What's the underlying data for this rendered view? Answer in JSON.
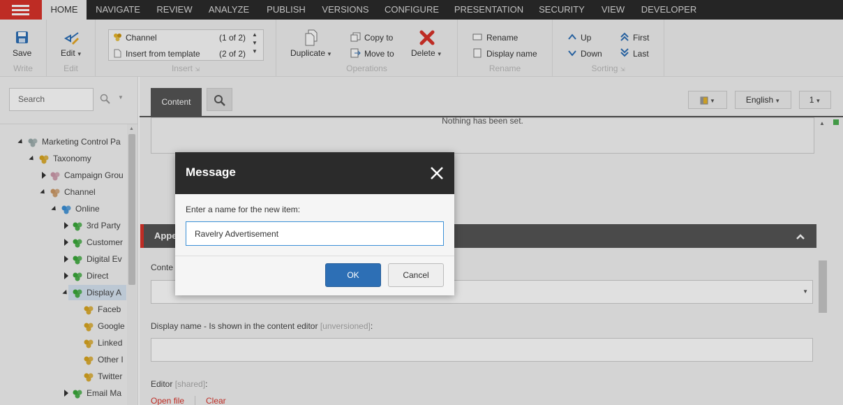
{
  "menu": {
    "tabs": [
      "HOME",
      "NAVIGATE",
      "REVIEW",
      "ANALYZE",
      "PUBLISH",
      "VERSIONS",
      "CONFIGURE",
      "PRESENTATION",
      "SECURITY",
      "VIEW",
      "DEVELOPER"
    ],
    "active": "HOME"
  },
  "ribbon": {
    "write": {
      "save": "Save",
      "label": "Write"
    },
    "edit": {
      "edit": "Edit",
      "label": "Edit"
    },
    "insert": {
      "items": [
        {
          "label": "Channel",
          "count": "(1 of 2)"
        },
        {
          "label": "Insert from template",
          "count": "(2 of 2)"
        }
      ],
      "label": "Insert"
    },
    "operations": {
      "duplicate": "Duplicate",
      "copy_to": "Copy to",
      "move_to": "Move to",
      "delete": "Delete",
      "label": "Operations"
    },
    "rename": {
      "rename": "Rename",
      "display_name": "Display name",
      "label": "Rename"
    },
    "sorting": {
      "up": "Up",
      "down": "Down",
      "first": "First",
      "last": "Last",
      "label": "Sorting"
    }
  },
  "search": {
    "placeholder": "Search"
  },
  "tree": [
    {
      "label": "Marketing Control Pa",
      "depth": 0,
      "state": "open",
      "icon": "control-panel-icon"
    },
    {
      "label": "Taxonomy",
      "depth": 1,
      "state": "open",
      "icon": "taxonomy-icon"
    },
    {
      "label": "Campaign Grou",
      "depth": 2,
      "state": "closed",
      "icon": "list-icon"
    },
    {
      "label": "Channel",
      "depth": 2,
      "state": "open",
      "icon": "channel-icon"
    },
    {
      "label": "Online",
      "depth": 3,
      "state": "open",
      "icon": "online-icon"
    },
    {
      "label": "3rd Party",
      "depth": 4,
      "state": "closed",
      "icon": "group-green-icon"
    },
    {
      "label": "Customer",
      "depth": 4,
      "state": "closed",
      "icon": "group-green-icon"
    },
    {
      "label": "Digital Ev",
      "depth": 4,
      "state": "closed",
      "icon": "group-green-icon"
    },
    {
      "label": "Direct",
      "depth": 4,
      "state": "closed",
      "icon": "group-green-icon"
    },
    {
      "label": "Display A",
      "depth": 4,
      "state": "open",
      "icon": "group-green-icon",
      "selected": true
    },
    {
      "label": "Faceb",
      "depth": 5,
      "state": "leaf",
      "icon": "group-yellow-icon"
    },
    {
      "label": "Google",
      "depth": 5,
      "state": "leaf",
      "icon": "group-yellow-icon"
    },
    {
      "label": "Linked",
      "depth": 5,
      "state": "leaf",
      "icon": "group-yellow-icon"
    },
    {
      "label": "Other I",
      "depth": 5,
      "state": "leaf",
      "icon": "group-yellow-icon"
    },
    {
      "label": "Twitter",
      "depth": 5,
      "state": "leaf",
      "icon": "group-yellow-icon"
    },
    {
      "label": "Email Ma",
      "depth": 4,
      "state": "closed",
      "icon": "group-green-icon"
    }
  ],
  "editor": {
    "content_tab": "Content",
    "language": "English",
    "version": "1",
    "nothing_set": "Nothing has been set.",
    "section_title": "Appea",
    "content_label": "Conte",
    "display_name_label": "Display name - Is shown in the content editor",
    "display_name_tag": "[unversioned]",
    "display_name_suffix": ":",
    "editor_label": "Editor",
    "editor_tag": "[shared]",
    "editor_suffix": ":",
    "open_file": "Open file",
    "clear": "Clear"
  },
  "dialog": {
    "title": "Message",
    "prompt": "Enter a name for the new item:",
    "value": "Ravelry Advertisement",
    "ok": "OK",
    "cancel": "Cancel"
  },
  "colors": {
    "accent": "#d9332a",
    "primary": "#2d6fb5",
    "dark": "#2b2b2b"
  }
}
